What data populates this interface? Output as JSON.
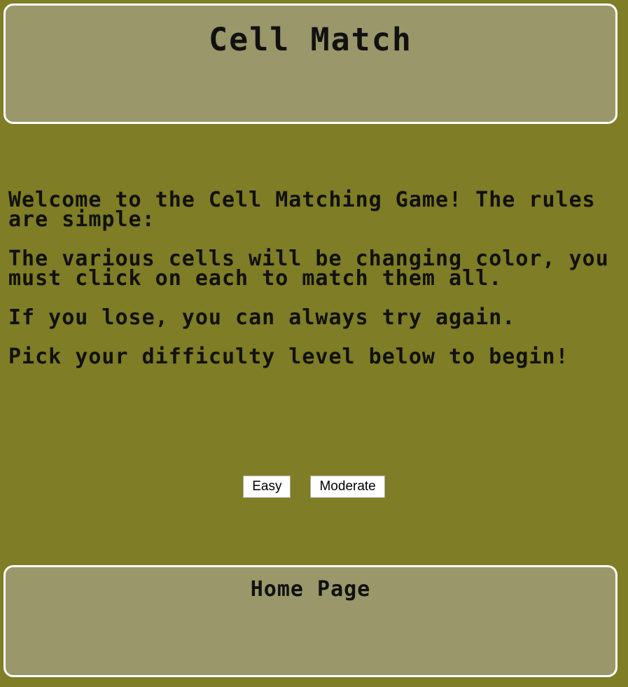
{
  "header": {
    "title": "Cell Match"
  },
  "intro": {
    "paragraphs": [
      "Welcome to the Cell Matching Game! The rules are simple:",
      "The various cells will be changing color, you must click on each to match them all.",
      "If you lose, you can always try again.",
      "Pick your difficulty level below to begin!"
    ]
  },
  "difficulty": {
    "easy_label": "Easy",
    "moderate_label": "Moderate"
  },
  "footer": {
    "link_label": "Home Page"
  },
  "colors": {
    "background": "#7f7d25",
    "panel": "#9a976a",
    "panel_border": "#ffffff",
    "text": "#111111"
  }
}
